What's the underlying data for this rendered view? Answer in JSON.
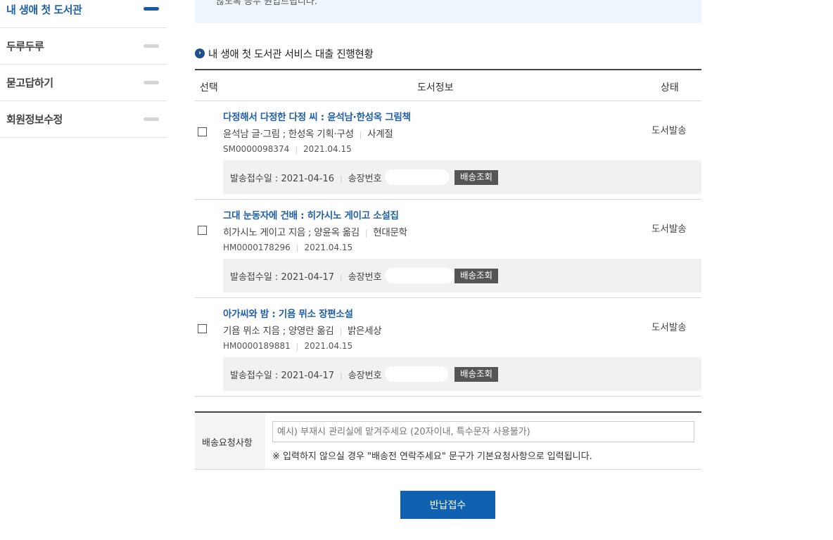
{
  "sidebar": {
    "items": [
      {
        "label": "내 생애 첫 도서관",
        "active": true
      },
      {
        "label": "두루두루",
        "active": false
      },
      {
        "label": "묻고답하기",
        "active": false
      },
      {
        "label": "회원정보수정",
        "active": false
      }
    ]
  },
  "notice": {
    "text": "않도록 등두 원입드립니다."
  },
  "section": {
    "title": "내 생애 첫 도서관 서비스 대출 진행현황"
  },
  "table": {
    "headers": {
      "select": "선택",
      "info": "도서정보",
      "status": "상태"
    },
    "rows": [
      {
        "title": "다정해서 다정한 다정 씨 : 윤석남·한성옥 그림책",
        "author": "윤석남 글·그림 ; 한성옥 기획·구성",
        "publisher": "사계절",
        "code": "SM0000098374",
        "date": "2021.04.15",
        "status": "도서발송",
        "ship_label": "발송접수일 : 2021-04-16",
        "tracking_label": "송장번호 :",
        "track_button": "배송조회"
      },
      {
        "title": "그대 눈동자에 건배 : 히가시노 게이고 소설집",
        "author": "히가시노 게이고 지음 ; 양윤옥 옮김",
        "publisher": "현대문학",
        "code": "HM0000178296",
        "date": "2021.04.15",
        "status": "도서발송",
        "ship_label": "발송접수일 : 2021-04-17",
        "tracking_label": "송장번호 :",
        "track_button": "배송조회"
      },
      {
        "title": "아가씨와 밤 : 기욤 뮈소 장편소설",
        "author": "기욤 뮈소 지음 ; 양영란 옮김",
        "publisher": "밝은세상",
        "code": "HM0000189881",
        "date": "2021.04.15",
        "status": "도서발송",
        "ship_label": "발송접수일 : 2021-04-17",
        "tracking_label": "송장번호 :",
        "track_button": "배송조회"
      }
    ]
  },
  "request": {
    "label": "배송요청사항",
    "placeholder": "예시) 부재시 관리실에 맡겨주세요 (20자이내, 특수문자 사용불가)",
    "note": "※ 입력하지 않으실 경우 \"배송전 연락주세요\" 문구가 기본요청사항으로 입력됩니다."
  },
  "submit": {
    "label": "반납접수"
  },
  "colors": {
    "accent": "#1f5fa6",
    "button": "#1161b1",
    "track_button": "#555555"
  }
}
